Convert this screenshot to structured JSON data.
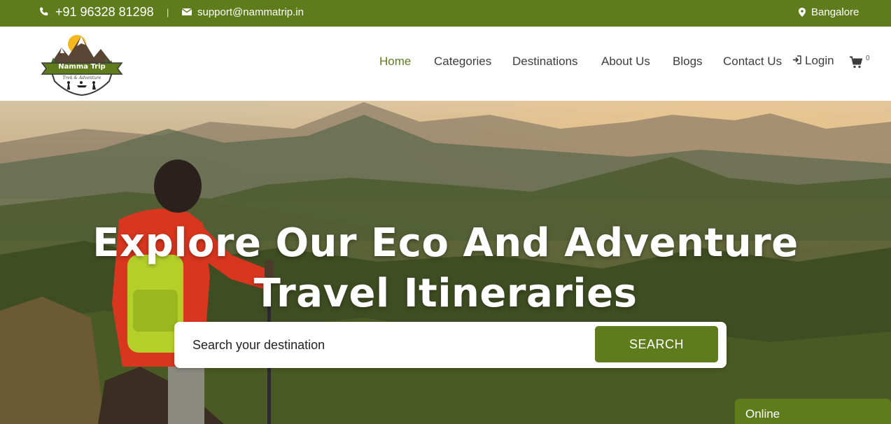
{
  "topbar": {
    "phone": "+91 96328 81298",
    "separator": "|",
    "email": "support@nammatrip.in",
    "location": "Bangalore",
    "icons": [
      "phone-icon",
      "mail-icon",
      "map-pin-icon"
    ]
  },
  "brand": {
    "logo_title": "Namma Trip",
    "logo_subtitle": "Trek & Adventure"
  },
  "nav": {
    "items": [
      {
        "label": "Home",
        "active": true
      },
      {
        "label": "Categories",
        "active": false
      },
      {
        "label": "Destinations",
        "active": false
      },
      {
        "label": "About Us",
        "active": false
      },
      {
        "label": "Blogs",
        "active": false
      },
      {
        "label": "Contact Us",
        "active": false
      }
    ],
    "login_label": "Login",
    "cart_count": "0",
    "icons": [
      "login-icon",
      "cart-icon"
    ]
  },
  "hero": {
    "title_line1": "Explore Our Eco And Adventure",
    "title_line2": "Travel Itineraries"
  },
  "search": {
    "placeholder": "Search your destination",
    "button_label": "SEARCH"
  },
  "chat": {
    "status_label": "Online"
  },
  "colors": {
    "brand_green": "#5f7c1d",
    "nav_text": "#3d3d3d"
  }
}
